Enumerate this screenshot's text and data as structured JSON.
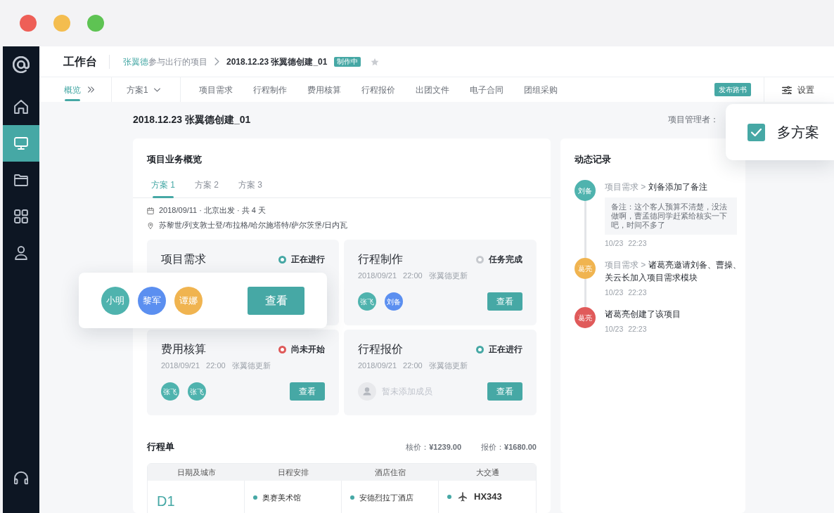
{
  "window": {
    "controls": [
      {
        "color": "#ee5f57"
      },
      {
        "color": "#f4bd4f"
      },
      {
        "color": "#5ec353"
      }
    ]
  },
  "sidebar": {
    "items": [
      {
        "kind": "home",
        "selected": false
      },
      {
        "kind": "monitor",
        "selected": true
      },
      {
        "kind": "folder",
        "selected": false
      },
      {
        "kind": "grid",
        "selected": false
      },
      {
        "kind": "user",
        "selected": false
      }
    ]
  },
  "header": {
    "title": "工作台",
    "breadcrumb": {
      "owner": "张翼德",
      "parent": "参与出行的项目",
      "current": "2018.12.23 张翼德创建_01",
      "badge": "制作中",
      "starred": false
    }
  },
  "nav": {
    "tabs": [
      {
        "label": "概览",
        "selected": true
      },
      {
        "label": "项目需求",
        "selected": false
      },
      {
        "label": "行程制作",
        "selected": false
      },
      {
        "label": "费用核算",
        "selected": false
      },
      {
        "label": "行程报价",
        "selected": false
      },
      {
        "label": "出团文件",
        "selected": false
      },
      {
        "label": "电子合同",
        "selected": false
      },
      {
        "label": "团组采购",
        "selected": false
      }
    ],
    "plan_select": "方案1",
    "publish_button": "发布路书",
    "settings_button": "设置"
  },
  "page": {
    "title": "2018.12.23 张翼德创建_01",
    "manager_label": "项目管理者："
  },
  "overview": {
    "title": "项目业务概览",
    "tabs": [
      {
        "label": "方案 1",
        "selected": true
      },
      {
        "label": "方案 2",
        "selected": false
      },
      {
        "label": "方案 3",
        "selected": false
      }
    ],
    "info": [
      {
        "kind": "calendar",
        "text": "2018/09/11 · 北京出发 · 共 4 天"
      },
      {
        "kind": "location",
        "text": "苏黎世/列支敦士登/布拉格/哈尔施塔特/萨尔茨堡/日内瓦"
      }
    ],
    "tasks": [
      {
        "title": "项目需求",
        "status": {
          "text": "正在进行",
          "color": "#46a8a5"
        }
      },
      {
        "title": "行程制作",
        "status": {
          "text": "任务完成",
          "color": "#c6c9ce"
        },
        "updated": "2018/09/21 22:00 张翼德更新",
        "members": [
          {
            "name": "张飞",
            "color": "#4fb3ae"
          },
          {
            "name": "刘备",
            "color": "#5b8ff0"
          }
        ],
        "view_button": "查看"
      },
      {
        "title": "费用核算",
        "status": {
          "text": "尚未开始",
          "color": "#e05a5a"
        },
        "updated": "2018/09/21 22:00 张翼德更新",
        "members": [
          {
            "name": "张飞",
            "color": "#4fb3ae"
          },
          {
            "name": "张飞",
            "color": "#4fb3ae"
          }
        ],
        "view_button": "查看"
      },
      {
        "title": "行程报价",
        "status": {
          "text": "正在进行",
          "color": "#46a8a5"
        },
        "updated": "2018/09/21 22:00 张翼德更新",
        "empty_members": "暂未添加成员",
        "view_button": "查看"
      }
    ]
  },
  "callout": {
    "members": [
      {
        "name": "小明",
        "color": "#4fb3ae"
      },
      {
        "name": "黎军",
        "color": "#5b8ff0"
      },
      {
        "name": "谭娜",
        "color": "#f0b450"
      }
    ],
    "button": "查看"
  },
  "itinerary": {
    "title": "行程单",
    "totals": [
      "核价：**¥1239.00**",
      "报价：**¥1680.00**"
    ],
    "table": {
      "columns": [
        "日期及城市",
        "日程安排",
        "酒店住宿",
        "大交通"
      ],
      "rows": [
        {
          "day": "D1",
          "schedule": [
            "奥赛美术馆"
          ],
          "hotels": [
            "安德烈拉丁酒店"
          ],
          "transport": [
            {
              "kind": "flight",
              "code": "HX343"
            }
          ]
        }
      ]
    }
  },
  "activity": {
    "title": "动态记录",
    "items": [
      {
        "avatar": "刘备",
        "color": "#4fb3ae",
        "path": "项目需求 >",
        "text": "刘备添加了备注",
        "note": "备注：这个客人预算不清楚，没法做啊，曹孟德同学赶紧给核实一下吧，时间不多了",
        "time": "10/23 22:23"
      },
      {
        "avatar": "葛亮",
        "color": "#f0b450",
        "path": "项目需求 >",
        "text": "诸葛亮邀请刘备、曹操、关云长加入项目需求模块",
        "time": "10/23 22:23"
      },
      {
        "avatar": "葛亮",
        "color": "#e05a5a",
        "text": "诸葛亮创建了该项目",
        "time": "10/23 22:23"
      }
    ]
  },
  "settings_popup": {
    "checked": true,
    "label": "多方案"
  }
}
